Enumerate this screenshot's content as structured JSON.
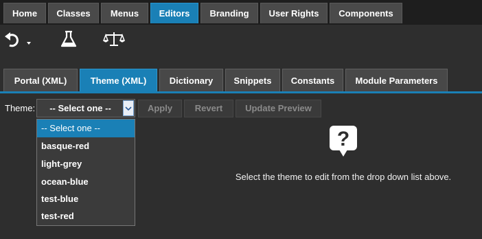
{
  "nav": {
    "tabs": [
      {
        "label": "Home"
      },
      {
        "label": "Classes"
      },
      {
        "label": "Menus"
      },
      {
        "label": "Editors"
      },
      {
        "label": "Branding"
      },
      {
        "label": "User Rights"
      },
      {
        "label": "Components"
      }
    ],
    "active": "Editors"
  },
  "toolbar": {
    "icons": [
      "undo-icon",
      "dropdown-caret-icon",
      "flask-icon",
      "scales-icon"
    ]
  },
  "subtabs": {
    "tabs": [
      {
        "label": "Portal (XML)"
      },
      {
        "label": "Theme (XML)"
      },
      {
        "label": "Dictionary"
      },
      {
        "label": "Snippets"
      },
      {
        "label": "Constants"
      },
      {
        "label": "Module Parameters"
      }
    ],
    "active": "Theme (XML)"
  },
  "theme": {
    "label": "Theme:",
    "selected": "-- Select one --",
    "options": [
      "-- Select one --",
      "basque-red",
      "light-grey",
      "ocean-blue",
      "test-blue",
      "test-red"
    ]
  },
  "actions": {
    "apply": "Apply",
    "revert": "Revert",
    "update_preview": "Update Preview"
  },
  "message": "Select the theme to edit from the drop down list above.",
  "colors": {
    "accent": "#1a80b6",
    "background": "#2e2e2e",
    "nav_bg": "#1e1e1e",
    "tab_bg": "#4a4a4a"
  }
}
